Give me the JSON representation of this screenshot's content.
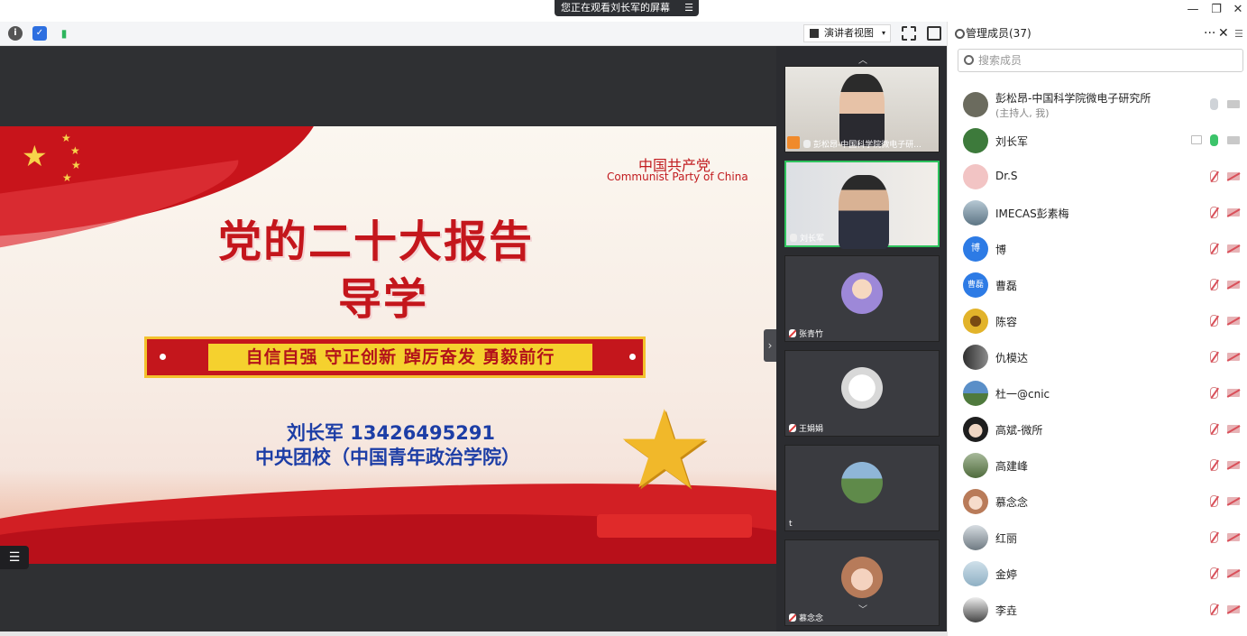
{
  "banner": {
    "text": "您正在观看刘长军的屏幕",
    "menu_icon": "menu-lines-icon"
  },
  "window": {
    "minimize": "—",
    "restore": "❐",
    "close": "✕"
  },
  "toolbar": {
    "info_icon": "info-icon",
    "shield_icon": "shield-icon",
    "signal_icon": "signal-bars-icon",
    "view_mode": "演讲者视图",
    "view_arrow": "▾",
    "fullscreen_icon": "fullscreen-icon",
    "layout_icon": "sidebar-layout-icon"
  },
  "slide": {
    "party_cn": "中国共产党",
    "party_en": "Communist Party of China",
    "title_line1": "党的二十大报告",
    "title_line2": "导学",
    "motto": "自信自强   守正创新   踔厉奋发  勇毅前行",
    "speaker": "刘长军   13426495291",
    "school": "中央团校（中国青年政治学院）",
    "star_glyph": "★",
    "list_glyph": "☰"
  },
  "strip": {
    "collapse_glyph": "›",
    "scroll_up": "︿",
    "scroll_down": "﹀",
    "tiles": [
      {
        "name": "彭松昂-中国科学院微电子研..."
      },
      {
        "name": "刘长军"
      },
      {
        "name": "张青竹"
      },
      {
        "name": "王娟娟"
      },
      {
        "name": "t"
      },
      {
        "name": "慕念念"
      }
    ]
  },
  "panel": {
    "title": "管理成员(37)",
    "more": "···",
    "close": "✕",
    "side": "☰",
    "search_placeholder": "搜索成员",
    "members": [
      {
        "name": "彭松昂-中国科学院微电子研究所",
        "sub": "(主持人, 我)",
        "avatar_color": "#6b6b5e"
      },
      {
        "name": "刘长军",
        "avatar_color": "#3d7a3b"
      },
      {
        "name": "Dr.S",
        "avatar_color": "#f2c4c4"
      },
      {
        "name": "IMECAS彭素梅",
        "avatar_color": "#6d8796"
      },
      {
        "name": "博",
        "avatar_text": "博",
        "avatar_color": "#2d7be5"
      },
      {
        "name": "曹磊",
        "avatar_text": "曹磊",
        "avatar_color": "#2d7be5"
      },
      {
        "name": "陈容",
        "avatar_color": "#e2b32a"
      },
      {
        "name": "仇模达",
        "avatar_color": "#3a3a3a"
      },
      {
        "name": "杜一@cnic",
        "avatar_color": "#4d78a8"
      },
      {
        "name": "高斌-微所",
        "avatar_color": "#1e1e1e"
      },
      {
        "name": "高建峰",
        "avatar_color": "#708a5a"
      },
      {
        "name": "慕念念",
        "avatar_color": "#e8b9a3"
      },
      {
        "name": "红丽",
        "avatar_color": "#8f9aa3"
      },
      {
        "name": "金婷",
        "avatar_color": "#a9c3d4"
      },
      {
        "name": "李垚",
        "avatar_color": "#555"
      }
    ]
  }
}
